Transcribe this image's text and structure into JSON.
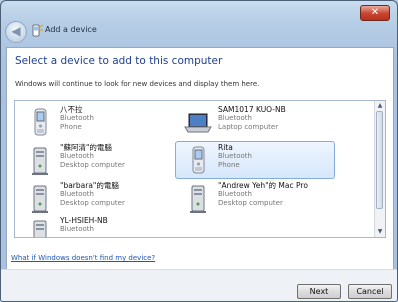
{
  "window": {
    "title": "Add a device",
    "close_glyph": "✕"
  },
  "nav": {
    "back_glyph": "◀"
  },
  "heading": "Select a device to add to this computer",
  "instructions": "Windows will continue to look for new devices and display them here.",
  "devices": [
    {
      "name": "八不拉",
      "type": "Bluetooth",
      "category": "Phone",
      "icon": "phone-icon",
      "selected": false
    },
    {
      "name": "SAM1017 KUO-NB",
      "type": "Bluetooth",
      "category": "Laptop computer",
      "icon": "laptop-icon",
      "selected": false
    },
    {
      "name": "\"蘇阿清\"的電腦",
      "type": "Bluetooth",
      "category": "Desktop computer",
      "icon": "desktop-icon",
      "selected": false
    },
    {
      "name": "Rita",
      "type": "Bluetooth",
      "category": "Phone",
      "icon": "phone-icon",
      "selected": true
    },
    {
      "name": "\"barbara\"的電腦",
      "type": "Bluetooth",
      "category": "Desktop computer",
      "icon": "desktop-icon",
      "selected": false
    },
    {
      "name": "\"Andrew Yeh\"的 Mac Pro",
      "type": "Bluetooth",
      "category": "Desktop computer",
      "icon": "desktop-icon",
      "selected": false
    },
    {
      "name": "YL-HSIEH-NB",
      "type": "Bluetooth",
      "category": "",
      "icon": "desktop-icon",
      "selected": false
    }
  ],
  "help_link": "What if Windows doesn't find my device?",
  "buttons": {
    "next": "Next",
    "cancel": "Cancel"
  }
}
